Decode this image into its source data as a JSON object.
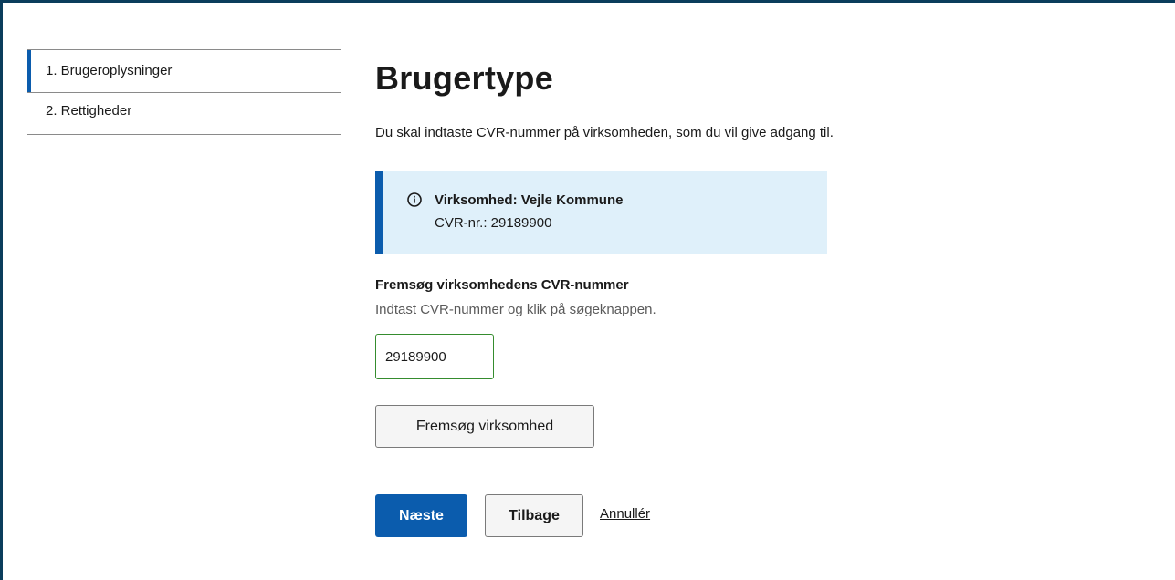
{
  "sidenav": {
    "items": [
      {
        "label": "1. Brugeroplysninger",
        "active": true
      },
      {
        "label": "2. Rettigheder",
        "active": false
      }
    ]
  },
  "main": {
    "title": "Brugertype",
    "intro": "Du skal indtaste CVR-nummer på virksomheden, som du vil give adgang til.",
    "alert": {
      "icon": "info-icon",
      "title": "Virksomhed: Vejle Kommune",
      "sub": "CVR-nr.: 29189900"
    },
    "cvr_field": {
      "label": "Fremsøg virksomhedens CVR-nummer",
      "hint": "Indtast CVR-nummer og klik på søgeknappen.",
      "value": "29189900"
    },
    "search_button": "Fremsøg virksomhed",
    "actions": {
      "next": "Næste",
      "back": "Tilbage",
      "cancel": "Annullér"
    }
  },
  "colors": {
    "primary": "#0b5cad",
    "alert_bg": "#dff0fa",
    "input_border_valid": "#358c2e",
    "frame": "#0b3d5c"
  }
}
